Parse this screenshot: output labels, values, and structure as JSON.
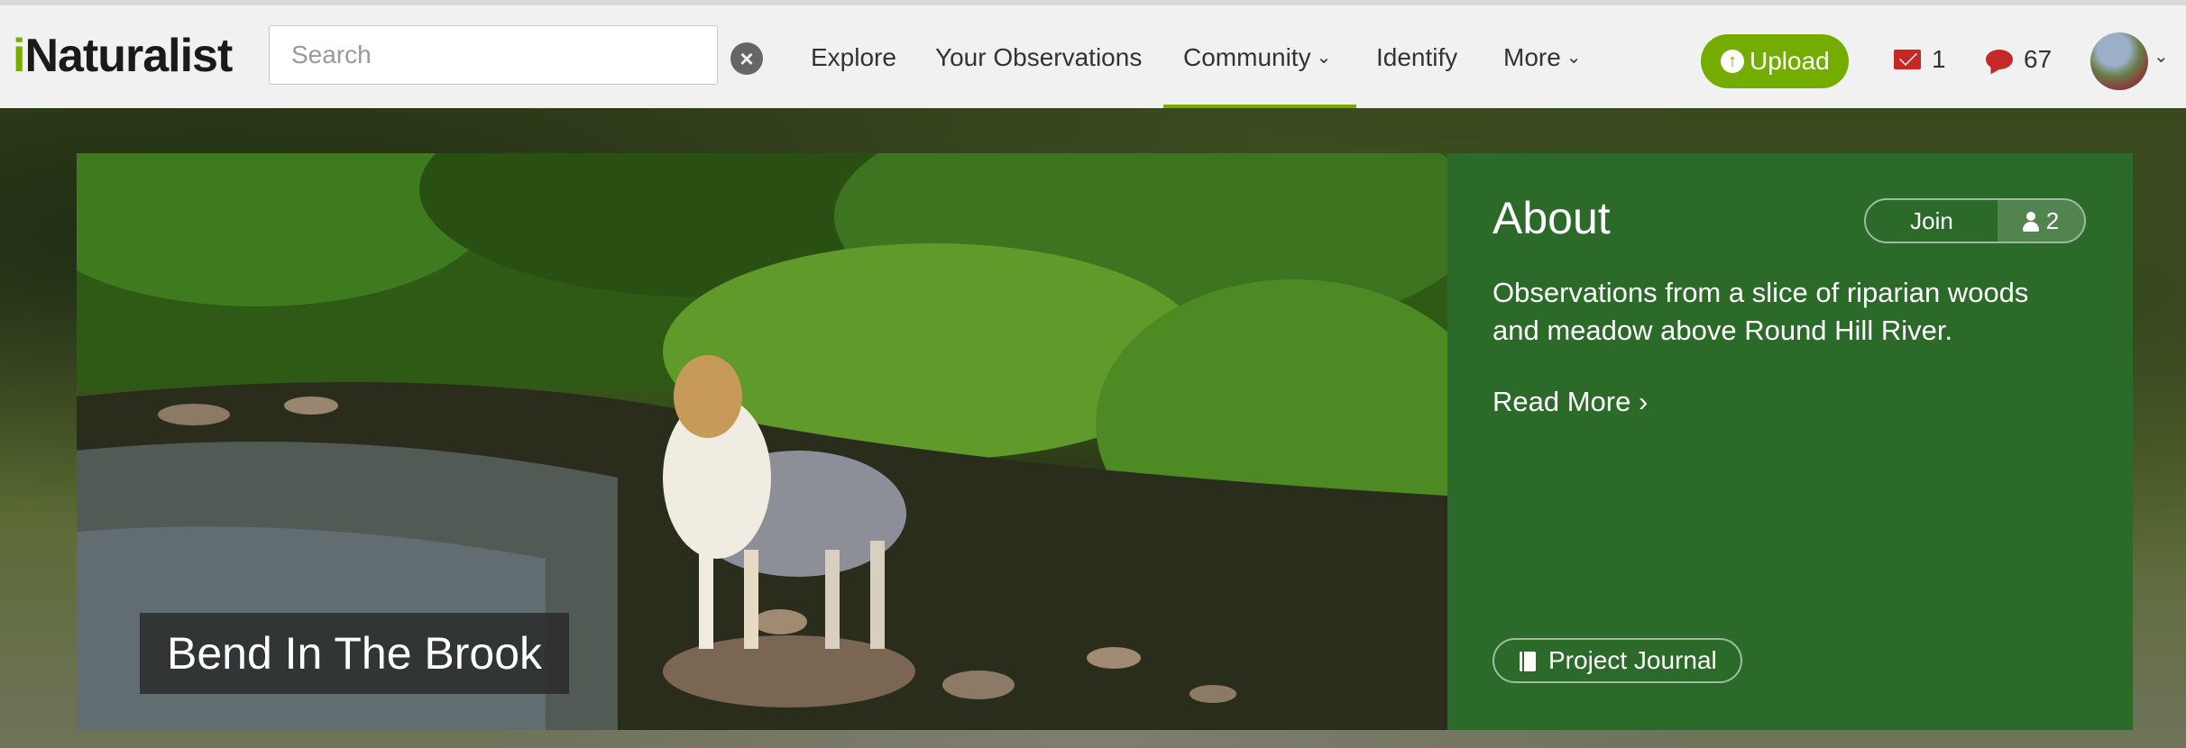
{
  "header": {
    "logo_prefix": "i",
    "logo_rest": "Naturalist",
    "search": {
      "placeholder": "Search",
      "value": ""
    },
    "nav": [
      {
        "label": "Explore"
      },
      {
        "label": "Your Observations"
      },
      {
        "label": "Community",
        "dropdown": true,
        "active": true
      },
      {
        "label": "Identify"
      },
      {
        "label": "More",
        "dropdown": true
      }
    ],
    "upload_label": "Upload",
    "messages_count": "1",
    "notifications_count": "67",
    "accent_color": "#74ac00"
  },
  "project": {
    "title": "Bend In The Brook",
    "about": {
      "heading": "About",
      "join_label": "Join",
      "members_count": "2",
      "description": "Observations from a slice of riparian woods and meadow above Round Hill River.",
      "read_more_label": "Read More",
      "journal_label": "Project Journal",
      "panel_color": "#2c6a2a"
    }
  }
}
